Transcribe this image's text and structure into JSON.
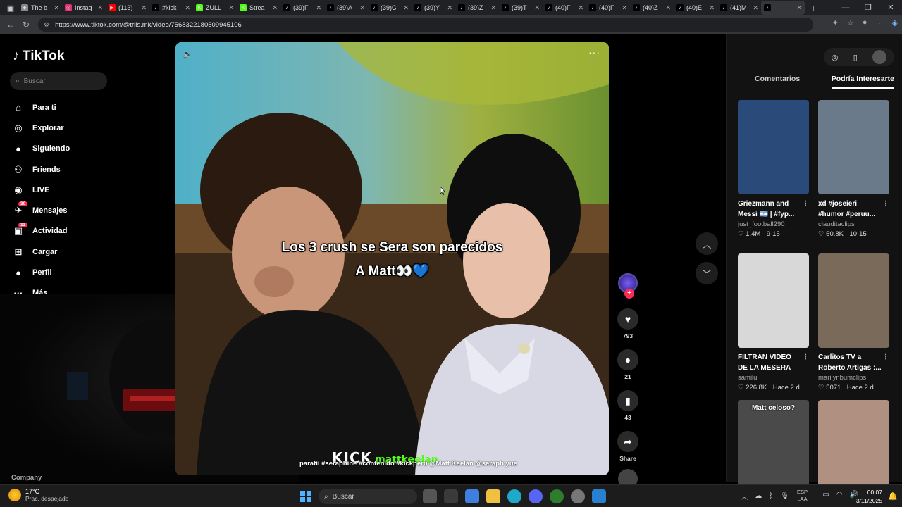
{
  "browser": {
    "tabs": [
      {
        "title": "The b",
        "color": "#888888",
        "glyph": "◆"
      },
      {
        "title": "Instag",
        "color": "#e1306c",
        "glyph": "◎"
      },
      {
        "title": "(113)",
        "color": "#ff0000",
        "glyph": "▶"
      },
      {
        "title": "#kick",
        "color": "#000000",
        "glyph": "♪"
      },
      {
        "title": "ZULL",
        "color": "#53fc18",
        "glyph": "K"
      },
      {
        "title": "Strea",
        "color": "#53fc18",
        "glyph": "K"
      },
      {
        "title": "(39)F",
        "color": "#000000",
        "glyph": "♪"
      },
      {
        "title": "(39)A",
        "color": "#000000",
        "glyph": "♪"
      },
      {
        "title": "(39)C",
        "color": "#000000",
        "glyph": "♪"
      },
      {
        "title": "(39)Y",
        "color": "#000000",
        "glyph": "♪"
      },
      {
        "title": "(39)Z",
        "color": "#000000",
        "glyph": "♪"
      },
      {
        "title": "(39)T",
        "color": "#000000",
        "glyph": "♪"
      },
      {
        "title": "(40)F",
        "color": "#000000",
        "glyph": "♪"
      },
      {
        "title": "(40)F",
        "color": "#000000",
        "glyph": "♪"
      },
      {
        "title": "(40)Z",
        "color": "#000000",
        "glyph": "♪"
      },
      {
        "title": "(40)E",
        "color": "#000000",
        "glyph": "♪"
      },
      {
        "title": "(41)M",
        "color": "#000000",
        "glyph": "♪"
      },
      {
        "title": "",
        "color": "#000000",
        "glyph": "♪",
        "active": true
      }
    ],
    "url": "https://www.tiktok.com/@triis.mk/video/7568322180509945106"
  },
  "sidebar": {
    "logo": "TikTok",
    "search_placeholder": "Buscar",
    "items": [
      {
        "label": "Para ti",
        "icon": "home-icon",
        "glyph": "⌂"
      },
      {
        "label": "Explorar",
        "icon": "compass-icon",
        "glyph": "◎"
      },
      {
        "label": "Siguiendo",
        "icon": "following-avatar-icon",
        "glyph": "●"
      },
      {
        "label": "Friends",
        "icon": "friends-icon",
        "glyph": "⚇"
      },
      {
        "label": "LIVE",
        "icon": "live-icon",
        "glyph": "◉"
      },
      {
        "label": "Mensajes",
        "icon": "messages-icon",
        "glyph": "✈",
        "badge": "30"
      },
      {
        "label": "Actividad",
        "icon": "activity-icon",
        "glyph": "▣",
        "badge": "11"
      },
      {
        "label": "Cargar",
        "icon": "upload-icon",
        "glyph": "⊞"
      },
      {
        "label": "Perfil",
        "icon": "profile-icon",
        "glyph": "●"
      },
      {
        "label": "Más",
        "icon": "more-icon",
        "glyph": "···"
      }
    ],
    "footer": "Company"
  },
  "video": {
    "caption_line1": "Los 3 crush se Sera son parecidos",
    "caption_line2": "A Matt👀💙",
    "kick_logo": "KICK",
    "kick_user": "mattkeelan",
    "hashtags": "paratii  #seraphine  #contenido  #kickperu  @Matt Keelan  @seraph yue"
  },
  "actions": {
    "likes": "793",
    "comments": "21",
    "saves": "43",
    "share": "Share"
  },
  "right_panel": {
    "tabs": [
      "Comentarios",
      "Podría Interesarte"
    ],
    "active_tab": 1,
    "cards": [
      {
        "title": "Griezmann and Messi 🇦🇷 | #fyp...",
        "author": "just_football290",
        "stats": "1.4M · 9-15",
        "bg": "#2a4a7a",
        "overlay": ""
      },
      {
        "title": "xd #joseieri #humor #peruu...",
        "author": "clauditaclips",
        "stats": "50.8K · 10-15",
        "bg": "#6a7a8a",
        "overlay": ""
      },
      {
        "title": "FILTRAN VIDEO DE LA MESERA LE...",
        "author": "samilu",
        "stats": "226.8K · Hace 2 d",
        "bg": "#d8d8d8",
        "overlay": ""
      },
      {
        "title": "Carlitos TV a Roberto Artigas :...",
        "author": "marilynbumclips",
        "stats": "5071 · Hace 2 d",
        "bg": "#7a6a5a",
        "overlay": ""
      },
      {
        "title": "",
        "author": "",
        "stats": "",
        "bg": "#4a4a4a",
        "overlay": "Matt celoso?"
      },
      {
        "title": "",
        "author": "",
        "stats": "",
        "bg": "#b09080",
        "overlay": ""
      }
    ]
  },
  "taskbar": {
    "temperature": "17°C",
    "weather": "Prac. despejado",
    "search": "Buscar",
    "lang_line1": "ESP",
    "lang_line2": "LAA",
    "time": "00:07",
    "date": "3/11/2025"
  }
}
